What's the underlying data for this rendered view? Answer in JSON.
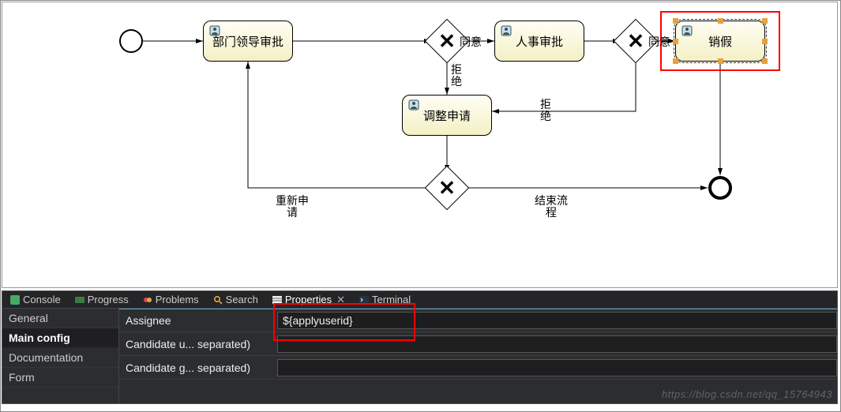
{
  "diagram": {
    "events": {
      "start": "Start Event",
      "end": "End Event"
    },
    "tasks": {
      "dept_leader": "部门领导审批",
      "hr": "人事审批",
      "cancel_leave": "销假",
      "adjust": "调整申请"
    },
    "gateways": {
      "g1": "Exclusive Gateway",
      "g2": "Exclusive Gateway",
      "g3": "Exclusive Gateway"
    },
    "labels": {
      "agree1": "同意",
      "agree2": "同意",
      "reject1": "拒\n绝",
      "reject2": "拒\n绝",
      "resubmit": "重新申\n请",
      "end_flow": "结束流\n程"
    }
  },
  "panel": {
    "tabs": {
      "console": "Console",
      "progress": "Progress",
      "problems": "Problems",
      "search": "Search",
      "properties": "Properties",
      "terminal": "Terminal"
    },
    "sidebar": {
      "general": "General",
      "main_config": "Main config",
      "documentation": "Documentation",
      "form": "Form"
    },
    "fields": {
      "assignee_label": "Assignee",
      "assignee_value": "${applyuserid}",
      "cand_users_label": "Candidate u... separated)",
      "cand_users_value": "",
      "cand_groups_label": "Candidate g... separated)",
      "cand_groups_value": ""
    }
  },
  "watermark": "https://blog.csdn.net/qq_15764943"
}
